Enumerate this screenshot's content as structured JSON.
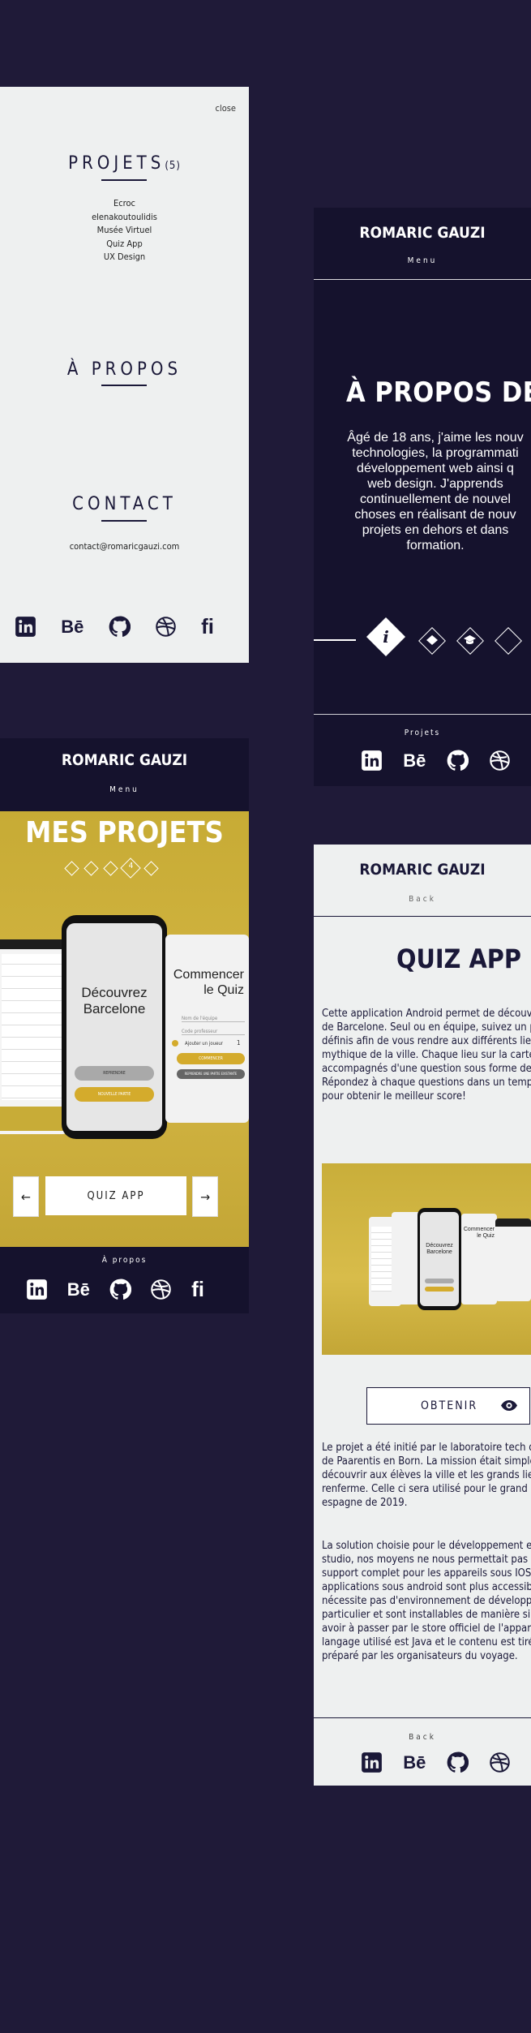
{
  "brand": "ROMARIC GAUZI",
  "menu_panel": {
    "close_label": "close",
    "projects_title": "PROJETS",
    "projects_count": "(5)",
    "projects": [
      "Ecroc",
      "elenakoutoulidis",
      "Musée Virtuel",
      "Quiz App",
      "UX Design"
    ],
    "about_title": "À PROPOS",
    "contact_title": "CONTACT",
    "email": "contact@romaricgauzi.com"
  },
  "social": [
    "linkedin-icon",
    "behance-icon",
    "github-icon",
    "dribbble-icon",
    "fi-icon"
  ],
  "social_labels": {
    "behance": "Bē",
    "fi": "fi"
  },
  "apropos_panel": {
    "menu_label": "Menu",
    "title": "À PROPOS DE MO",
    "body_lines": [
      "Âgé de 18 ans, j'aime les nouv",
      "technologies, la programmati",
      "développement web ainsi q",
      "web design. J'apprends",
      "continuellement de nouvel",
      "choses en réalisant de nouv",
      "projets en dehors et dans",
      "formation."
    ],
    "info_glyph": "i",
    "footer_link": "Projets"
  },
  "projets_panel": {
    "menu_label": "Menu",
    "title": "MES PROJETS",
    "current_page": "4",
    "prev_arrow": "←",
    "next_arrow": "→",
    "project_button": "QUIZ APP",
    "footer_link": "À propos",
    "mockup": {
      "phone_text": [
        "Découvrez",
        "Barcelone"
      ],
      "phone_buttons": [
        "REPRENDRE",
        "NOUVELLE PARTIE"
      ],
      "card_title": [
        "Commencer",
        "le Quiz"
      ],
      "card_fields": [
        "Nom de l'équipe",
        "Code professeur"
      ],
      "card_add": "Ajouter un joueur",
      "card_add_count": "1",
      "card_buttons": [
        "COMMENCER",
        "REPRENDRE UNE PARTIE EXISTANTE"
      ]
    }
  },
  "quiz_panel": {
    "back_label": "Back",
    "title": "QUIZ APP",
    "intro_lines": [
      "Cette application Android permet de découvri",
      "de Barcelone. Seul ou en équipe, suivez un pa",
      "définis afin de vous rendre aux différents lieu",
      "mythique de la ville. Chaque lieu sur la carte s",
      "accompagnés d'une question sous forme de Q",
      "Répondez à chaque questions dans un temps",
      "pour obtenir le meilleur score!"
    ],
    "get_button": "OBTENIR",
    "para2_lines": [
      "Le projet a été initié par le laboratoire tech du",
      "de Paarentis en Born. La mission était simple",
      "découvrir aux élèves la ville et les grands lieu",
      "renferme. Celle ci sera utilisé pour le grand d",
      "espagne de 2019."
    ],
    "para3_lines": [
      "La solution choisie pour le développement es",
      "studio, nos moyens ne nous permettait pas d'",
      "support complet pour les appareils sous IOS.",
      "applications sous android sont plus accessibl",
      "nécessite pas d'environnement de développer",
      "particulier et sont installables de manière sim",
      "avoir à passer par le store officiel de l'appare",
      "langage utilisé est Java et le contenu est tiré",
      "préparé par les organisateurs du voyage."
    ],
    "footer_link": "Back",
    "mini_mockup": {
      "phone_text": [
        "Découvrez",
        "Barcelone"
      ],
      "card_title": [
        "Commencer",
        "le Quiz"
      ]
    }
  },
  "colors": {
    "navy": "#15122d",
    "page_bg": "#1f1a38",
    "panel_light": "#eef0f0",
    "accent_yellow": "#d4b643"
  }
}
